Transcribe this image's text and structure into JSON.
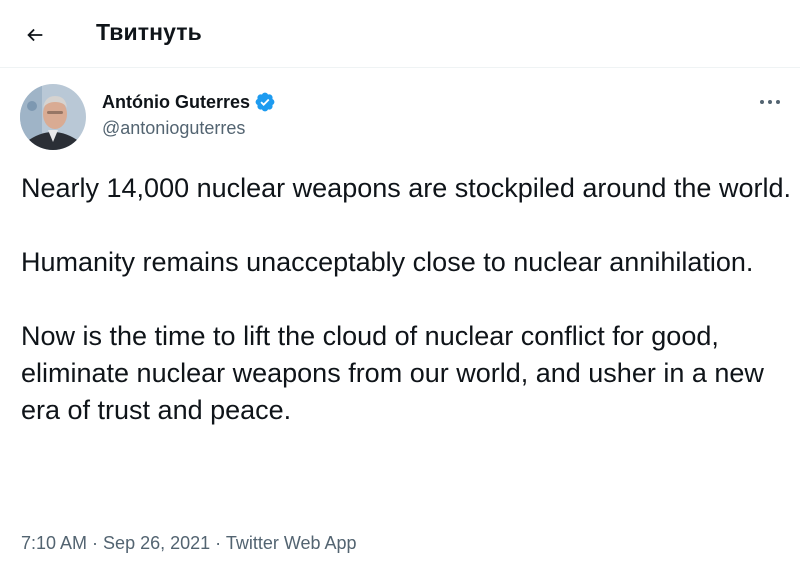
{
  "header": {
    "title": "Твитнуть",
    "back_icon": "arrow-left-icon"
  },
  "author": {
    "name": "António Guterres",
    "handle": "@antonioguterres",
    "verified_icon": "verified-badge-icon",
    "verified_color": "#1d9bf0"
  },
  "tweet": {
    "paragraphs": [
      "Nearly 14,000 nuclear weapons are stockpiled around the world.",
      "Humanity remains unacceptably close to nuclear annihilation.",
      "Now is the time to lift the cloud of nuclear conflict for good, eliminate nuclear weapons from our world, and usher in a new era of trust and peace."
    ],
    "time": "7:10 AM",
    "separator": " · ",
    "date": "Sep 26, 2021",
    "source": "Twitter Web App"
  },
  "menu": {
    "more_icon": "more-horizontal-icon"
  }
}
